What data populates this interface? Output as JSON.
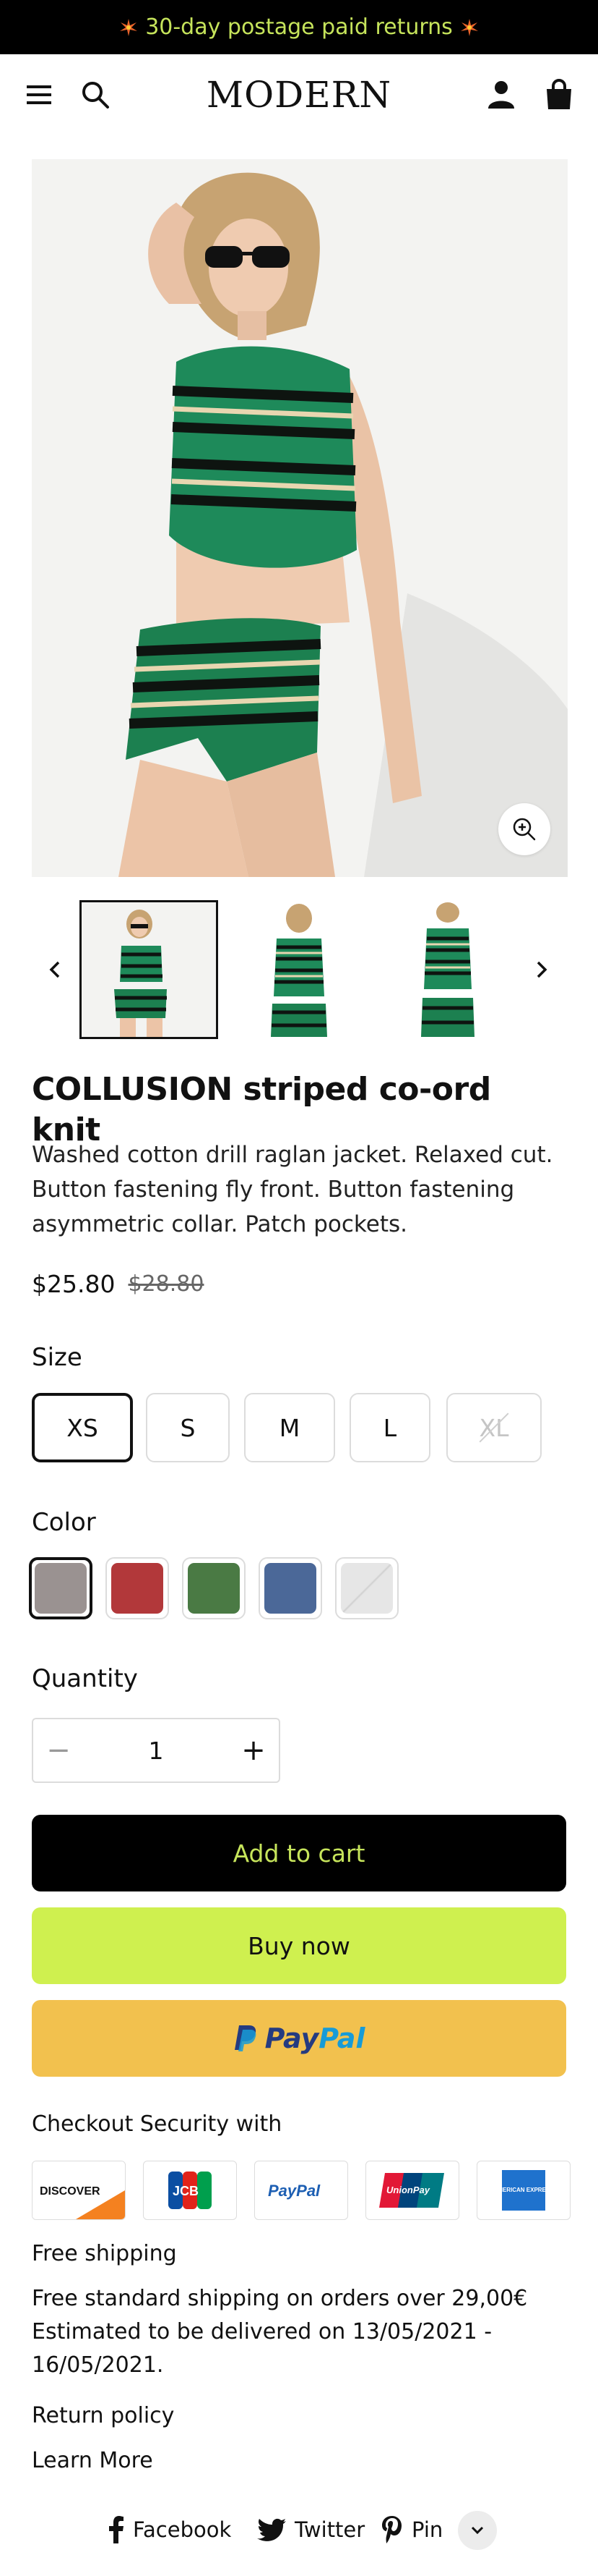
{
  "announcement": {
    "text": "30-day postage paid returns",
    "icon": "sparkle-icon",
    "accent": "#c6e45b"
  },
  "header": {
    "logo": "MODERN",
    "icons": [
      "menu-icon",
      "search-icon",
      "account-icon",
      "bag-icon"
    ]
  },
  "gallery": {
    "main_image": "model in green, black and cream striped sleeveless crop top and shorts, wearing sunglasses",
    "thumbnails_count": 3,
    "selected_thumbnail": 1
  },
  "product": {
    "title": "COLLUSION striped co-ord knit",
    "description": "Washed cotton drill raglan jacket. Relaxed cut. Button fastening fly front. Button fastening asymmetric collar. Patch pockets.",
    "price": "$25.80",
    "compare_price": "$28.80"
  },
  "size": {
    "label": "Size",
    "options": [
      "XS",
      "S",
      "M",
      "L",
      "XL"
    ],
    "selected": "XS",
    "unavailable": [
      "XL"
    ]
  },
  "color": {
    "label": "Color",
    "swatches": [
      "#9a9291",
      "#b2383a",
      "#4a7a44",
      "#4b6898",
      "#e6e6e6"
    ],
    "selected_index": 0
  },
  "quantity": {
    "label": "Quantity",
    "value": "1",
    "minus": "−",
    "plus": "+"
  },
  "buttons": {
    "add_to_cart": "Add to cart",
    "buy_now": "Buy now"
  },
  "paypal": {
    "pay": "Pay",
    "pal": "Pal"
  },
  "checkout_security": {
    "title": "Checkout Security with",
    "cards": [
      "DISCOVER",
      "JCB",
      "PayPal",
      "UnionPay",
      "AMERICAN EXPRESS"
    ]
  },
  "shipping": {
    "title": "Free shipping",
    "line1": "Free standard shipping on orders over 29,00€",
    "line2": "Estimated to be delivered on 13/05/2021 -",
    "line3": "16/05/2021."
  },
  "links": {
    "return_policy": "Return policy",
    "learn_more": "Learn More"
  },
  "share": {
    "facebook": "Facebook",
    "twitter": "Twitter",
    "pin": "Pin"
  }
}
